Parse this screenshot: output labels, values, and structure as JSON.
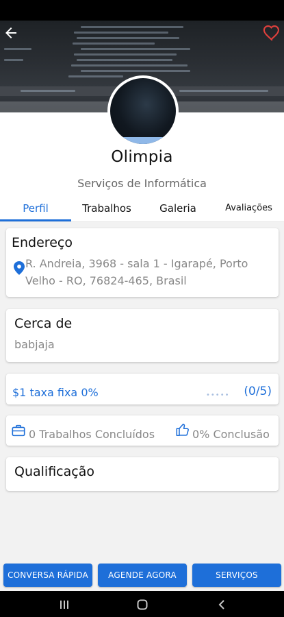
{
  "profile": {
    "name": "Olimpia",
    "category": "Serviços de Informática"
  },
  "tabs": [
    {
      "label": "Perfil",
      "active": true
    },
    {
      "label": "Trabalhos",
      "active": false
    },
    {
      "label": "Galeria",
      "active": false
    },
    {
      "label": "Avaliações",
      "active": false
    }
  ],
  "address": {
    "title": "Endereço",
    "line1": "R. Andreia, 3968 - sala 1 - Igarapé, Porto",
    "line2": "Velho - RO, 76824-465, Brasil",
    "icon": "location-pin-icon"
  },
  "about": {
    "title": "Cerca de",
    "text": "babjaja"
  },
  "rating": {
    "fee_text": "$1 taxa fixa 0%",
    "stars_value": 0,
    "stars_max": 5,
    "score": "(0/5)"
  },
  "stats": {
    "jobs_done": "0 Trabalhos Concluídos",
    "completion": "0% Conclusão",
    "jobs_icon": "briefcase-icon",
    "completion_icon": "thumbs-up-icon"
  },
  "qualification": {
    "title": "Qualificação"
  },
  "actions": {
    "quick_chat": "CONVERSA RÁPIDA",
    "schedule_now": "AGENDE AGORA",
    "services": "SERVIÇOS"
  },
  "colors": {
    "accent": "#1e6fd9",
    "favorite": "#e0403c"
  },
  "icons": {
    "back": "back-arrow-icon",
    "favorite": "heart-outline-icon",
    "nav_recents": "recents-icon",
    "nav_home": "home-icon",
    "nav_back": "nav-back-icon"
  }
}
